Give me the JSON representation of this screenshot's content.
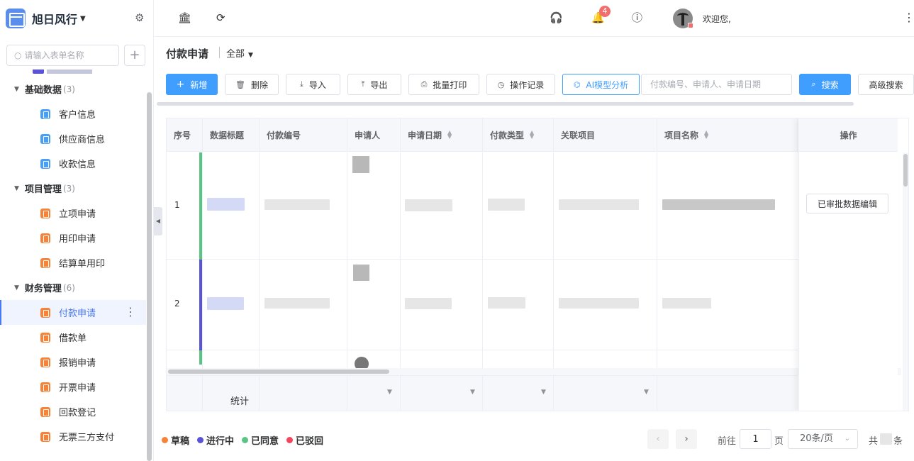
{
  "sidebar": {
    "brand": "旭日风行",
    "search_placeholder": "请输入表单名称",
    "add_label": "+",
    "groups": [
      {
        "name": "基础数据",
        "count": "(3)",
        "items": [
          "客户信息",
          "供应商信息",
          "收款信息"
        ]
      },
      {
        "name": "项目管理",
        "count": "(3)",
        "items": [
          "立项申请",
          "用印申请",
          "结算单用印"
        ]
      },
      {
        "name": "财务管理",
        "count": "(6)",
        "items": [
          "付款申请",
          "借款单",
          "报销申请",
          "开票申请",
          "回款登记",
          "无票三方支付"
        ]
      }
    ],
    "active_item": "付款申请"
  },
  "topbar": {
    "notification_count": "4",
    "welcome": "欢迎您,"
  },
  "page": {
    "title": "付款申请",
    "filter": "全部"
  },
  "toolbar": {
    "new": "新增",
    "delete": "删除",
    "import": "导入",
    "export": "导出",
    "batch_print": "批量打印",
    "op_log": "操作记录",
    "ai": "AI模型分析",
    "search_placeholder": "付款编号、申请人、申请日期",
    "search": "搜索",
    "advanced": "高级搜索"
  },
  "table": {
    "columns": [
      "序号",
      "数据标题",
      "付款编号",
      "申请人",
      "申请日期",
      "付款类型",
      "关联项目",
      "项目名称"
    ],
    "op_header": "操作",
    "rows": [
      {
        "index": "1",
        "status_color": "#5cc387"
      },
      {
        "index": "2",
        "status_color": "#5b53d6"
      }
    ],
    "row1_action": "已审批数据编辑",
    "summary_label": "统计"
  },
  "legend": [
    {
      "label": "草稿",
      "color": "#f5843a"
    },
    {
      "label": "进行中",
      "color": "#5b53d6"
    },
    {
      "label": "已同意",
      "color": "#5cc387"
    },
    {
      "label": "已驳回",
      "color": "#f5455c"
    }
  ],
  "pagination": {
    "goto_label": "前往",
    "page": "1",
    "page_unit": "页",
    "page_size": "20条/页",
    "total_prefix": "共",
    "total_suffix": "条"
  }
}
